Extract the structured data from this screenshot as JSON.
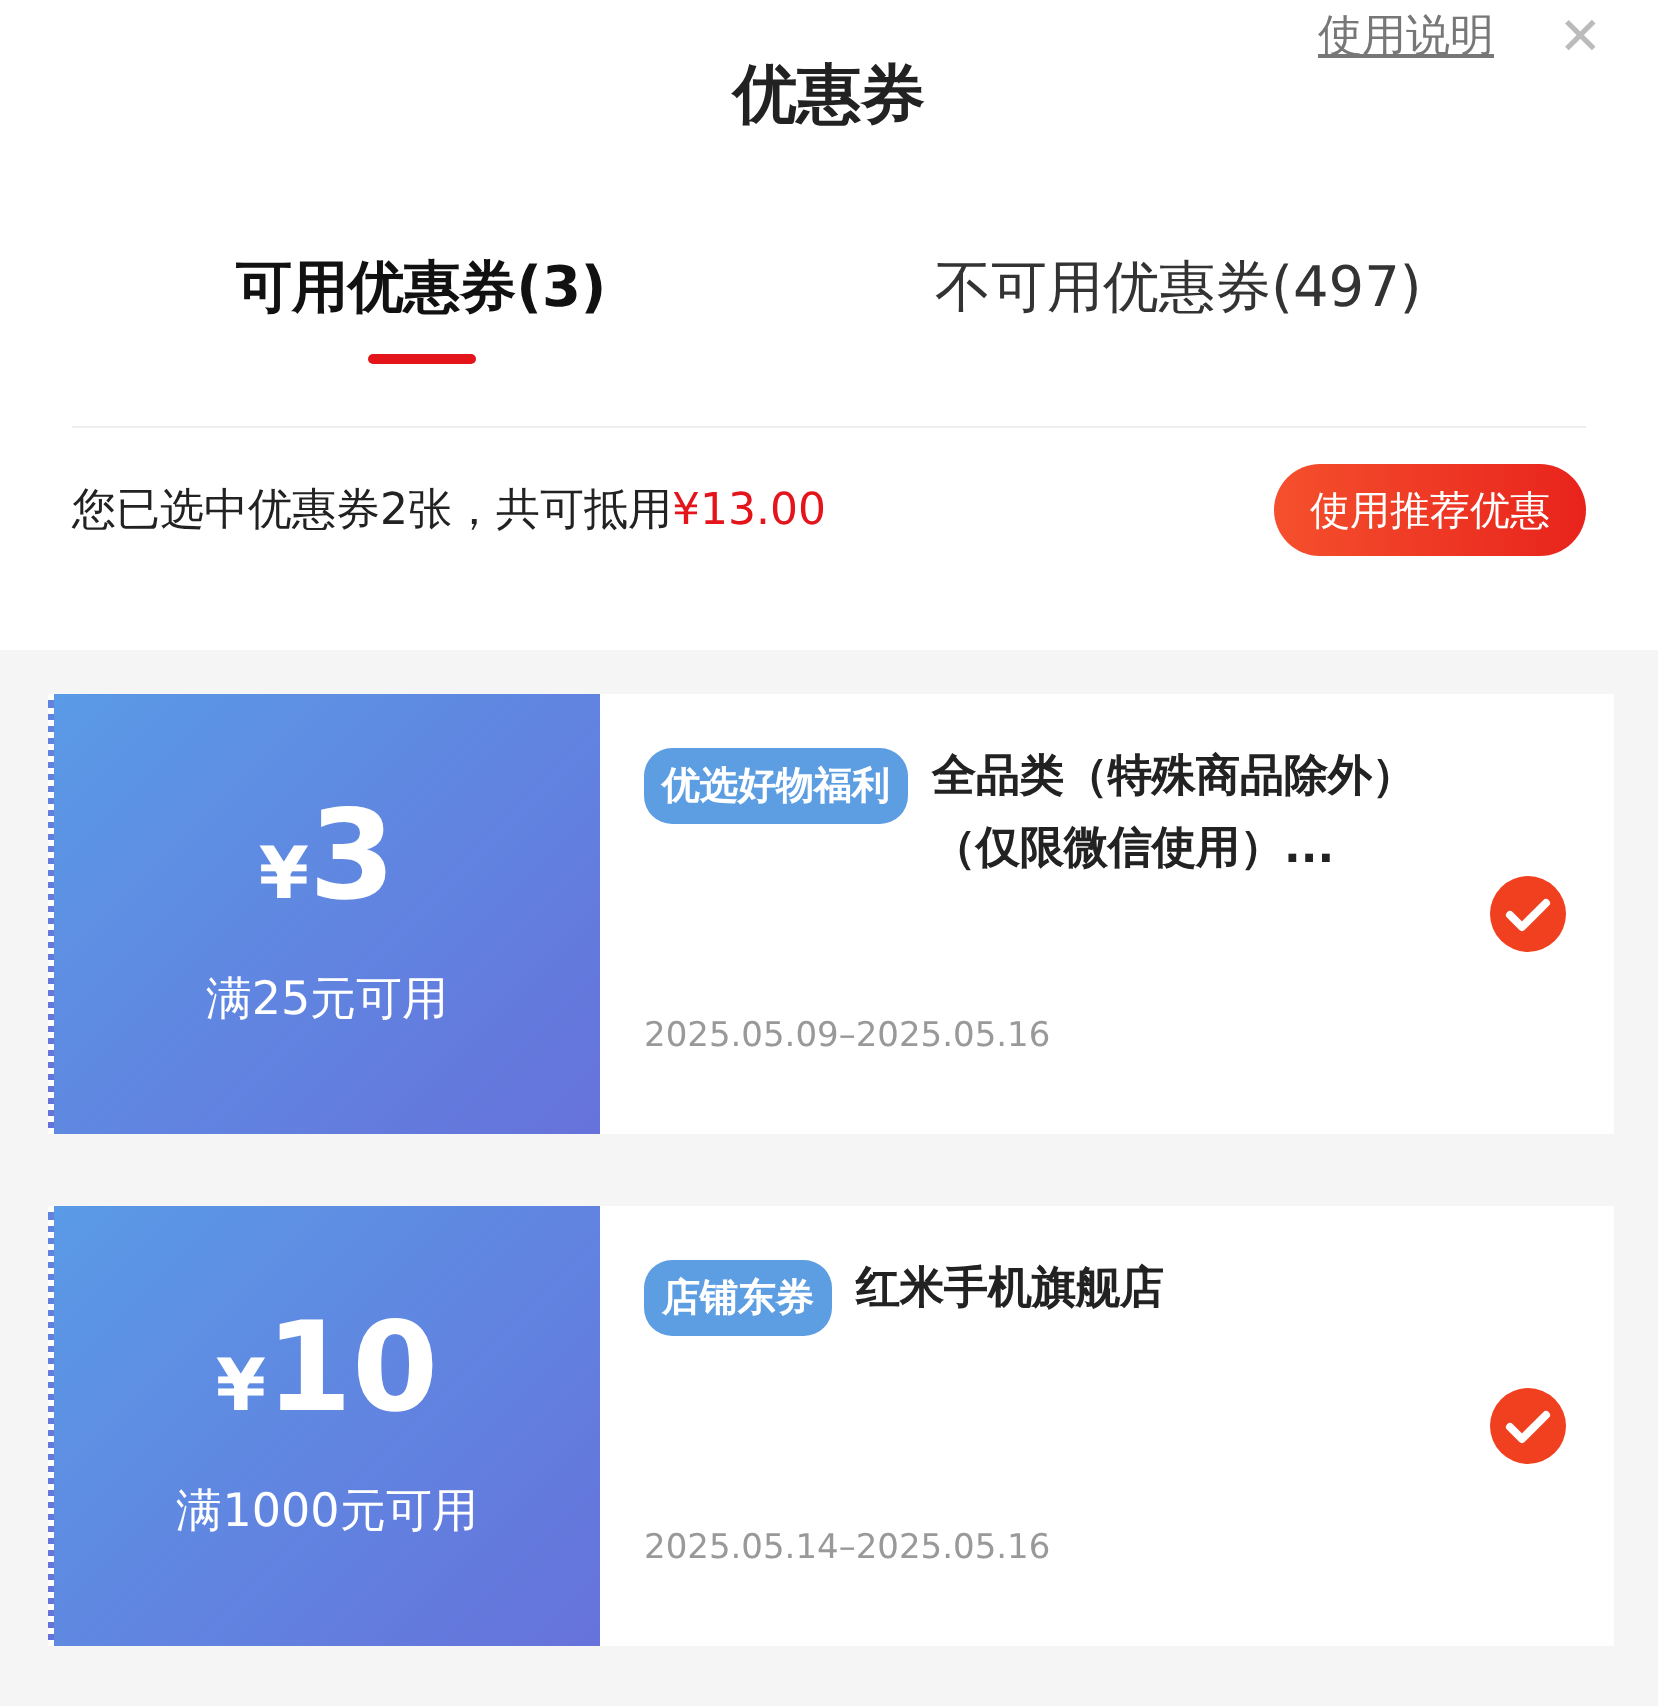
{
  "header": {
    "title": "优惠券",
    "help_link": "使用说明",
    "close": "✕"
  },
  "tabs": [
    {
      "label": "可用优惠券(3)",
      "selected": true
    },
    {
      "label": "不可用优惠券(497)",
      "selected": false
    }
  ],
  "summary": {
    "text": "您已选中优惠券2张，共可抵用",
    "amount": "¥13.00",
    "button": "使用推荐优惠"
  },
  "coupons": [
    {
      "currency": "¥",
      "value": "3",
      "condition": "满25元可用",
      "tag": "优选好物福利",
      "title": "全品类（特殊商品除外）（仅限微信使用）...",
      "validity": "2025.05.09–2025.05.16",
      "checked": true
    },
    {
      "currency": "¥",
      "value": "10",
      "condition": "满1000元可用",
      "tag": "店铺东券",
      "title": "红米手机旗舰店",
      "validity": "2025.05.14–2025.05.16",
      "checked": true
    }
  ]
}
